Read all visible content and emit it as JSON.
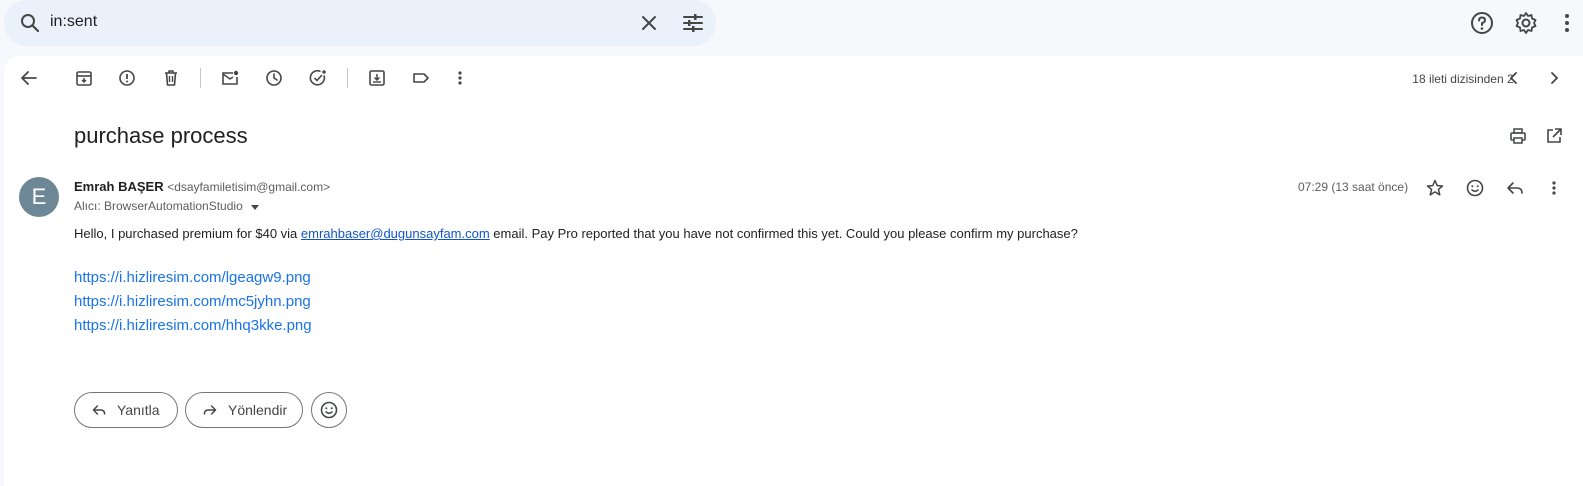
{
  "search": {
    "query": "in:sent"
  },
  "toolbar": {
    "thread_count": "18 ileti dizisinden 2."
  },
  "message": {
    "subject": "purchase process",
    "avatar_letter": "E",
    "sender_name": "Emrah BAŞER",
    "sender_email": "<dsayfamiletisim@gmail.com>",
    "to_label": "Alıcı: BrowserAutomationStudio",
    "time": "07:29 (13 saat önce)",
    "body_before": "Hello, I purchased premium for $40 via ",
    "body_link": "emrahbaser@dugunsayfam.com",
    "body_after": " email. Pay Pro reported that you have not confirmed this yet. Could you please confirm my purchase?",
    "links": [
      "https://i.hizliresim.com/lgeagw9.png",
      "https://i.hizliresim.com/mc5jyhn.png",
      "https://i.hizliresim.com/hhq3kke.png"
    ]
  },
  "actions": {
    "reply": "Yanıtla",
    "forward": "Yönlendir"
  },
  "icons": {
    "search": "search-icon",
    "clear": "close-icon",
    "tune": "tune-icon",
    "help": "help-icon",
    "settings": "gear-icon",
    "more": "more-vert-icon"
  }
}
